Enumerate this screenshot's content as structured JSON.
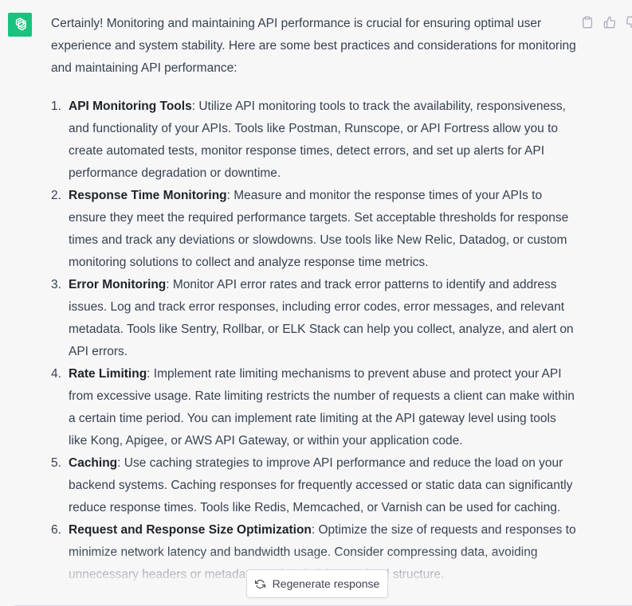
{
  "assistant": {
    "avatar_icon": "openai-logo-icon",
    "avatar_color": "#19c37d"
  },
  "message": {
    "intro": "Certainly! Monitoring and maintaining API performance is crucial for ensuring optimal user experience and system stability. Here are some best practices and considerations for monitoring and maintaining API performance:",
    "items": [
      {
        "number": "1.",
        "title": "API Monitoring Tools",
        "text": ": Utilize API monitoring tools to track the availability, responsiveness, and functionality of your APIs. Tools like Postman, Runscope, or API Fortress allow you to create automated tests, monitor response times, detect errors, and set up alerts for API performance degradation or downtime."
      },
      {
        "number": "2.",
        "title": "Response Time Monitoring",
        "text": ": Measure and monitor the response times of your APIs to ensure they meet the required performance targets. Set acceptable thresholds for response times and track any deviations or slowdowns. Use tools like New Relic, Datadog, or custom monitoring solutions to collect and analyze response time metrics."
      },
      {
        "number": "3.",
        "title": "Error Monitoring",
        "text": ": Monitor API error rates and track error patterns to identify and address issues. Log and track error responses, including error codes, error messages, and relevant metadata. Tools like Sentry, Rollbar, or ELK Stack can help you collect, analyze, and alert on API errors."
      },
      {
        "number": "4.",
        "title": "Rate Limiting",
        "text": ": Implement rate limiting mechanisms to prevent abuse and protect your API from excessive usage. Rate limiting restricts the number of requests a client can make within a certain time period. You can implement rate limiting at the API gateway level using tools like Kong, Apigee, or AWS API Gateway, or within your application code."
      },
      {
        "number": "5.",
        "title": "Caching",
        "text": ": Use caching strategies to improve API performance and reduce the load on your backend systems. Caching responses for frequently accessed or static data can significantly reduce response times. Tools like Redis, Memcached, or Varnish can be used for caching."
      },
      {
        "number": "6.",
        "title": "Request and Response Size Optimization",
        "text": ": Optimize the size of requests and responses to minimize network latency and bandwidth usage. Consider compressing data, avoiding unnecessary headers or metadata, and optimizing payload structure."
      }
    ]
  },
  "actions": {
    "copy_icon": "clipboard-icon",
    "like_icon": "thumbs-up-icon",
    "dislike_icon": "thumbs-down-icon"
  },
  "regenerate": {
    "label": "Regenerate response",
    "icon": "refresh-icon"
  }
}
